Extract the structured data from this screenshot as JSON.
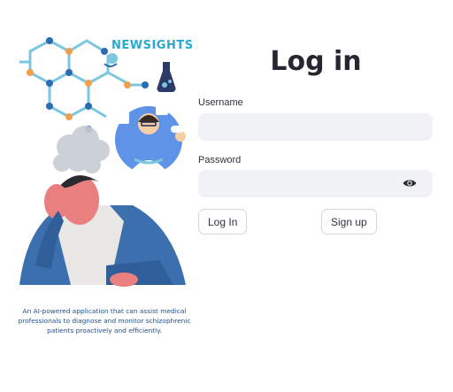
{
  "brand": {
    "name": "NEWSIGHTS"
  },
  "illustration": {
    "caption": "An AI-powered application that can assist medical professionals to diagnose and monitor schizophrenic patients proactively and efficiently."
  },
  "login": {
    "title": "Log in",
    "username_label": "Username",
    "username_value": "",
    "password_label": "Password",
    "password_value": "",
    "login_button": "Log In",
    "signup_button": "Sign up"
  },
  "colors": {
    "accent": "#2aa8d4",
    "input_bg": "#f0f2f6",
    "text": "#31333f",
    "caption": "#1f4e8a"
  },
  "icons": {
    "password_toggle": "eye-icon"
  }
}
